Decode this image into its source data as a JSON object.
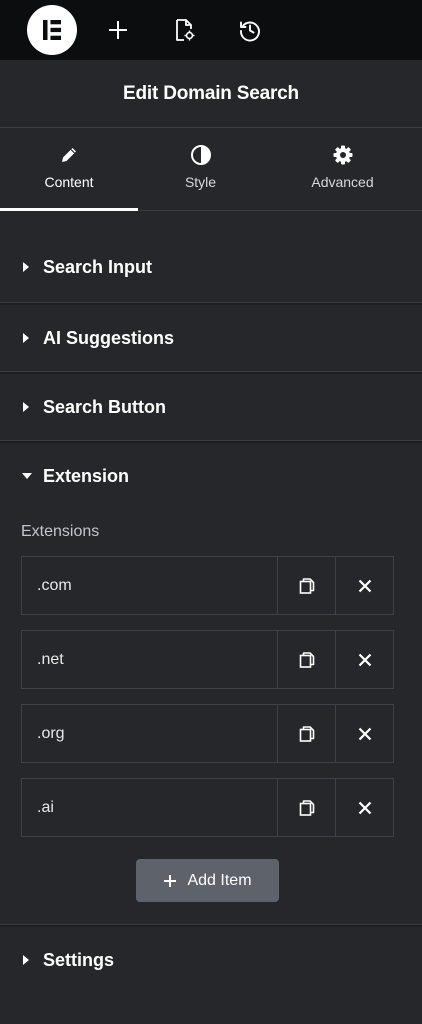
{
  "topbar": {
    "logo": "elementor-logo",
    "icons": [
      "add-icon",
      "page-settings-icon",
      "history-icon"
    ]
  },
  "header": {
    "title": "Edit Domain Search"
  },
  "tabs": [
    {
      "label": "Content",
      "icon": "pencil-icon",
      "active": true
    },
    {
      "label": "Style",
      "icon": "half-circle-icon",
      "active": false
    },
    {
      "label": "Advanced",
      "icon": "gear-icon",
      "active": false
    }
  ],
  "sections": [
    {
      "title": "Search Input",
      "expanded": false
    },
    {
      "title": "AI Suggestions",
      "expanded": false
    },
    {
      "title": "Search Button",
      "expanded": false
    },
    {
      "title": "Extension",
      "expanded": true
    },
    {
      "title": "Settings",
      "expanded": false
    }
  ],
  "extension": {
    "label": "Extensions",
    "items": [
      ".com",
      ".net",
      ".org",
      ".ai"
    ],
    "add_label": "Add Item"
  },
  "colors": {
    "panel_bg": "#26272b",
    "topbar_bg": "#0c0d0e",
    "add_button_bg": "#5e636b"
  }
}
